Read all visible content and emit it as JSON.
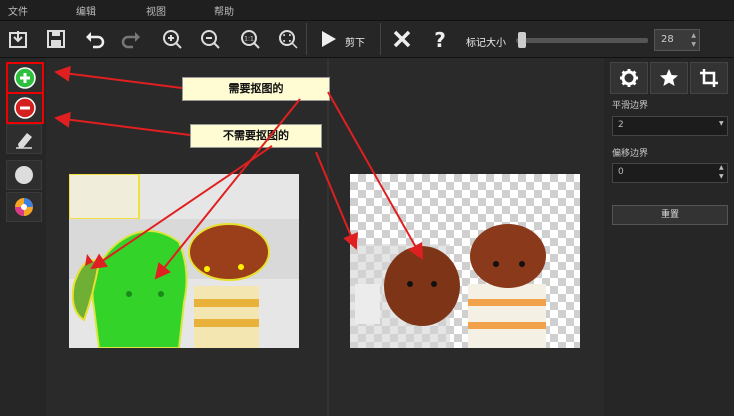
{
  "menu": [
    "文件",
    "编辑",
    "视图",
    "帮助"
  ],
  "toolbar": {
    "icons": [
      "import-icon",
      "save-icon",
      "undo-icon",
      "redo-icon",
      "zoom-in-icon",
      "zoom-out-icon",
      "zoom-1to1-icon",
      "zoom-fit-icon"
    ],
    "cut_label": "剪下",
    "mark_size_label": "标记大小",
    "mark_size_value": "28",
    "mark_size_level": 0.02
  },
  "left_tools": [
    "add-icon",
    "remove-icon",
    "eraser-icon",
    "blank-brush-icon",
    "color-brush-icon"
  ],
  "annotations": {
    "need": "需要抠图的",
    "no_need": "不需要抠图的"
  },
  "right_panel": {
    "tabs": [
      "gear-icon",
      "star-icon",
      "crop-icon"
    ],
    "smooth_label": "平滑边界",
    "smooth_value": "2",
    "offset_label": "偏移边界",
    "offset_value": "0",
    "reset_label": "重置"
  },
  "colors": {
    "accent_red": "#e02020",
    "add_green": "#2fbf3f",
    "remove_red": "#d52020",
    "mark_green": "#33d32a",
    "callout_bg": "#fffbd2"
  }
}
